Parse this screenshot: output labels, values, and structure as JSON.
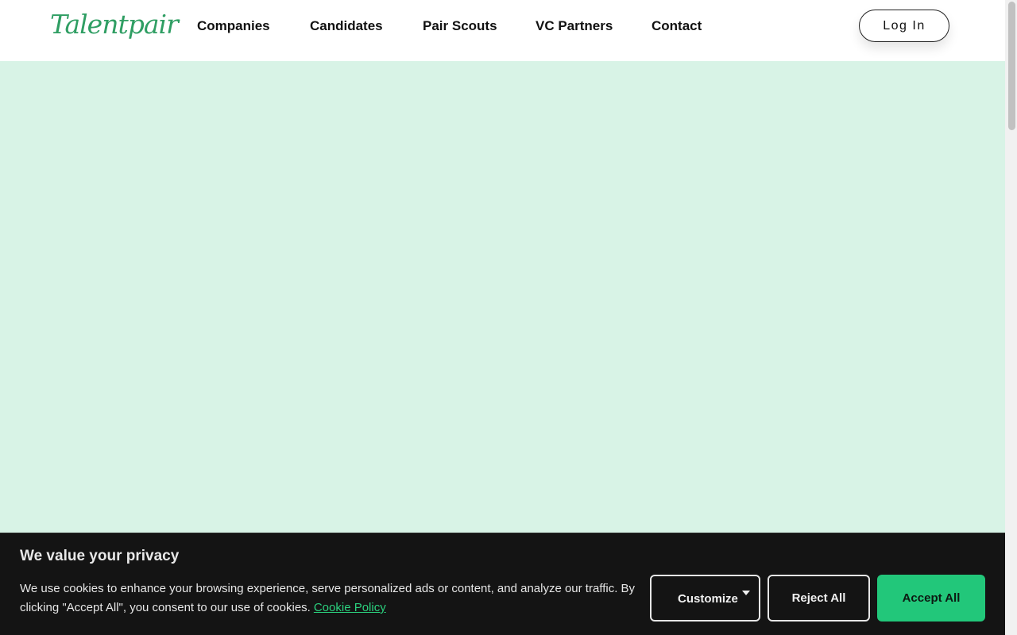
{
  "header": {
    "logo_text": "Talentpair",
    "nav": [
      {
        "label": "Companies"
      },
      {
        "label": "Candidates"
      },
      {
        "label": "Pair Scouts"
      },
      {
        "label": "VC Partners"
      },
      {
        "label": "Contact"
      }
    ],
    "login_label": "Log In"
  },
  "cookie_banner": {
    "title": "We value your privacy",
    "text": "We use cookies to enhance your browsing experience, serve personalized ads or content, and analyze our traffic. By clicking \"Accept All\", you consent to our use of cookies.",
    "policy_link": "Cookie Policy",
    "customize_label": "Customize",
    "reject_label": "Reject All",
    "accept_label": "Accept All"
  },
  "colors": {
    "brand_green": "#2f9e63",
    "hero_background": "#d8f3e6",
    "accept_green": "#22c77a",
    "banner_background": "#141414"
  }
}
